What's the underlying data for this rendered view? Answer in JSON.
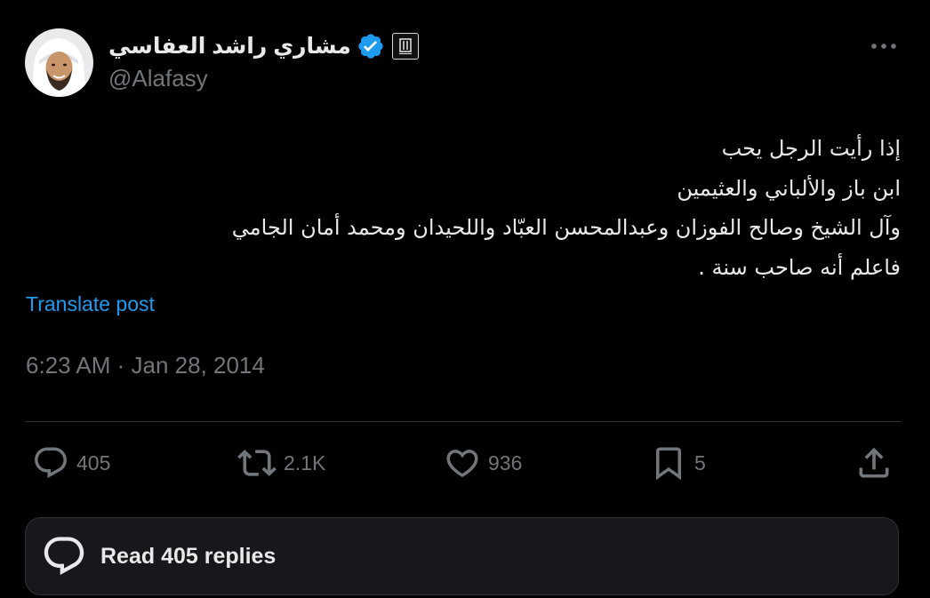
{
  "author": {
    "display_name": "مشاري راشد العفاسي",
    "handle": "@Alafasy",
    "verified": true,
    "avatar_icon": "profile-photo",
    "affiliate_badge_icon": "organization-badge-icon"
  },
  "tweet": {
    "lines": [
      "إذا رأيت الرجل يحب",
      "ابن باز والألباني والعثيمين",
      "وآل الشيخ وصالح الفوزان وعبدالمحسن العبّاد واللحيدان ومحمد أمان الجامي",
      "فاعلم أنه صاحب سنة ."
    ],
    "translate_label": "Translate post",
    "timestamp": "6:23 AM · Jan 28, 2014"
  },
  "actions": {
    "replies": "405",
    "reposts": "2.1K",
    "likes": "936",
    "bookmarks": "5"
  },
  "read_replies_label": "Read 405 replies",
  "colors": {
    "background": "#000000",
    "text_primary": "#e7e9ea",
    "text_secondary": "#71767b",
    "accent": "#1d9bf0",
    "divider": "#2f3336",
    "card_background": "#16181c"
  }
}
